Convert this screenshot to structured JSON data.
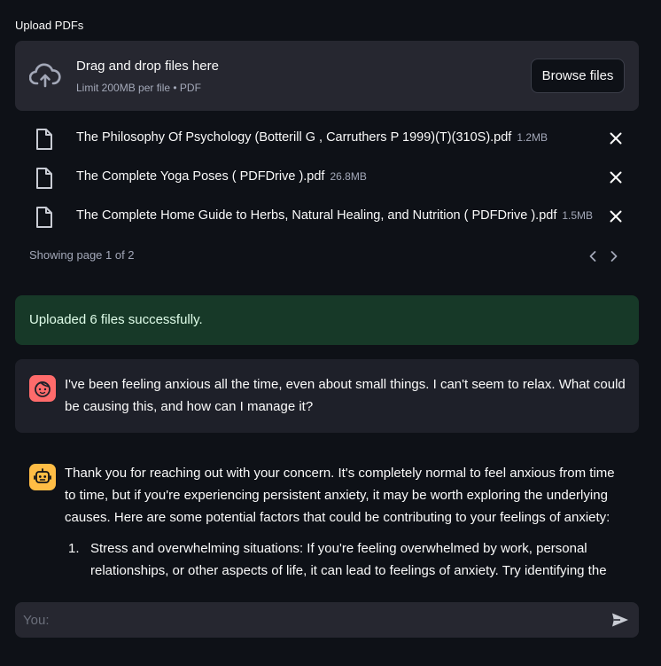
{
  "upload": {
    "label": "Upload PDFs",
    "dropzone_title": "Drag and drop files here",
    "dropzone_subtitle": "Limit 200MB per file • PDF",
    "browse_label": "Browse files"
  },
  "files": [
    {
      "name": "The Philosophy Of Psychology (Botterill G , Carruthers P 1999)(T)(310S).pdf",
      "size": "1.2MB"
    },
    {
      "name": "The Complete Yoga Poses ( PDFDrive ).pdf",
      "size": "26.8MB"
    },
    {
      "name": "The Complete Home Guide to Herbs, Natural Healing, and Nutrition ( PDFDrive ).pdf",
      "size": "1.5MB"
    }
  ],
  "pager": {
    "text": "Showing page 1 of 2"
  },
  "status": {
    "message": "Uploaded 6 files successfully."
  },
  "chat": {
    "user_message": "I've been feeling anxious all the time, even about small things. I can't seem to relax. What could be causing this, and how can I manage it?",
    "bot_intro": "Thank you for reaching out with your concern. It's completely normal to feel anxious from time to time, but if you're experiencing persistent anxiety, it may be worth exploring the underlying causes. Here are some potential factors that could be contributing to your feelings of anxiety:",
    "bot_list": [
      {
        "num": "1.",
        "text": "Stress and overwhelming situations: If you're feeling overwhelmed by work, personal relationships, or other aspects of life, it can lead to feelings of anxiety. Try identifying the"
      }
    ]
  },
  "input": {
    "placeholder": "You:",
    "value": ""
  },
  "colors": {
    "background": "#0e1117",
    "panel": "#262730",
    "success_bg": "#173928",
    "user_avatar": "#ff6b6b",
    "bot_avatar": "#ffbd45"
  },
  "icons": {
    "upload": "cloud-upload-icon",
    "file": "file-icon",
    "close": "close-icon",
    "prev": "chevron-left-icon",
    "next": "chevron-right-icon",
    "user": "user-face-icon",
    "bot": "robot-icon",
    "send": "send-icon"
  }
}
